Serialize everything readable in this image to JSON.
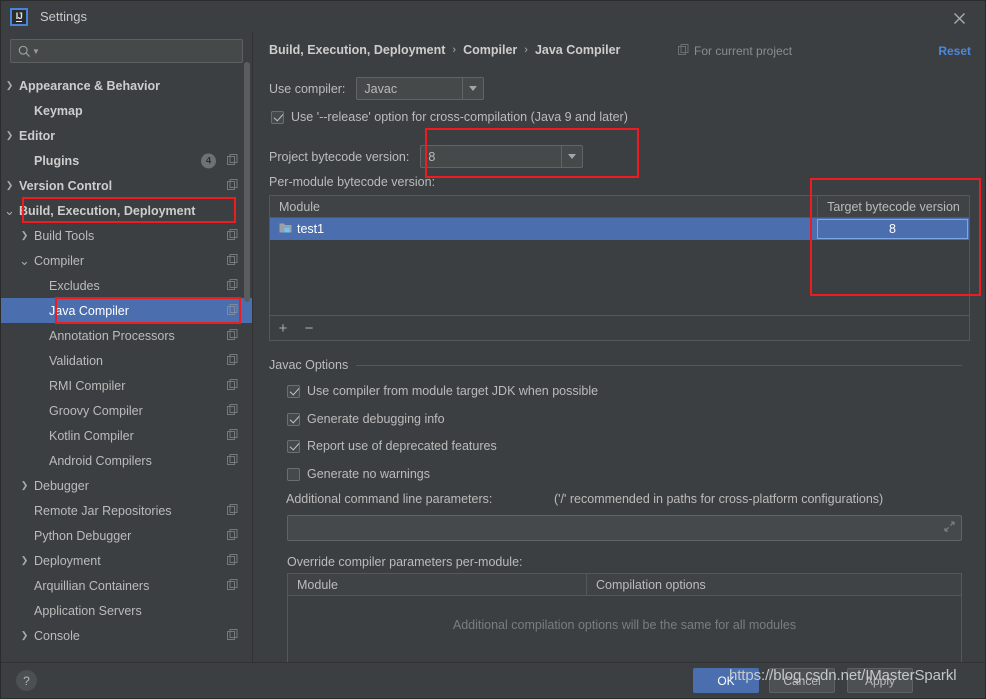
{
  "window": {
    "title": "Settings",
    "logo_text": "IJ",
    "close_icon": "close-icon"
  },
  "sidebar": {
    "search": {
      "placeholder": "",
      "value": "",
      "icon": "search-icon"
    },
    "items": [
      {
        "label": "Appearance & Behavior",
        "arrow": "›",
        "indent": 0,
        "bold": true,
        "copy": false,
        "badge": null,
        "selected": false
      },
      {
        "label": "Keymap",
        "arrow": "",
        "indent": 1,
        "bold": true,
        "copy": false,
        "badge": null,
        "selected": false
      },
      {
        "label": "Editor",
        "arrow": "›",
        "indent": 0,
        "bold": true,
        "copy": false,
        "badge": null,
        "selected": false
      },
      {
        "label": "Plugins",
        "arrow": "",
        "indent": 1,
        "bold": true,
        "copy": true,
        "badge": "4",
        "selected": false
      },
      {
        "label": "Version Control",
        "arrow": "›",
        "indent": 0,
        "bold": true,
        "copy": true,
        "badge": null,
        "selected": false
      },
      {
        "label": "Build, Execution, Deployment",
        "arrow": "∨",
        "indent": 0,
        "bold": true,
        "copy": false,
        "badge": null,
        "selected": false
      },
      {
        "label": "Build Tools",
        "arrow": "›",
        "indent": 1,
        "bold": false,
        "copy": true,
        "badge": null,
        "selected": false
      },
      {
        "label": "Compiler",
        "arrow": "∨",
        "indent": 1,
        "bold": false,
        "copy": true,
        "badge": null,
        "selected": false
      },
      {
        "label": "Excludes",
        "arrow": "",
        "indent": 2,
        "bold": false,
        "copy": true,
        "badge": null,
        "selected": false
      },
      {
        "label": "Java Compiler",
        "arrow": "",
        "indent": 2,
        "bold": false,
        "copy": true,
        "badge": null,
        "selected": true
      },
      {
        "label": "Annotation Processors",
        "arrow": "",
        "indent": 2,
        "bold": false,
        "copy": true,
        "badge": null,
        "selected": false
      },
      {
        "label": "Validation",
        "arrow": "",
        "indent": 2,
        "bold": false,
        "copy": true,
        "badge": null,
        "selected": false
      },
      {
        "label": "RMI Compiler",
        "arrow": "",
        "indent": 2,
        "bold": false,
        "copy": true,
        "badge": null,
        "selected": false
      },
      {
        "label": "Groovy Compiler",
        "arrow": "",
        "indent": 2,
        "bold": false,
        "copy": true,
        "badge": null,
        "selected": false
      },
      {
        "label": "Kotlin Compiler",
        "arrow": "",
        "indent": 2,
        "bold": false,
        "copy": true,
        "badge": null,
        "selected": false
      },
      {
        "label": "Android Compilers",
        "arrow": "",
        "indent": 2,
        "bold": false,
        "copy": true,
        "badge": null,
        "selected": false
      },
      {
        "label": "Debugger",
        "arrow": "›",
        "indent": 1,
        "bold": false,
        "copy": false,
        "badge": null,
        "selected": false
      },
      {
        "label": "Remote Jar Repositories",
        "arrow": "",
        "indent": 1,
        "bold": false,
        "copy": true,
        "badge": null,
        "selected": false
      },
      {
        "label": "Python Debugger",
        "arrow": "",
        "indent": 1,
        "bold": false,
        "copy": true,
        "badge": null,
        "selected": false
      },
      {
        "label": "Deployment",
        "arrow": "›",
        "indent": 1,
        "bold": false,
        "copy": true,
        "badge": null,
        "selected": false
      },
      {
        "label": "Arquillian Containers",
        "arrow": "",
        "indent": 1,
        "bold": false,
        "copy": true,
        "badge": null,
        "selected": false
      },
      {
        "label": "Application Servers",
        "arrow": "",
        "indent": 1,
        "bold": false,
        "copy": false,
        "badge": null,
        "selected": false
      },
      {
        "label": "Console",
        "arrow": "›",
        "indent": 1,
        "bold": false,
        "copy": true,
        "badge": null,
        "selected": false
      }
    ]
  },
  "main": {
    "breadcrumb": [
      "Build, Execution, Deployment",
      "Compiler",
      "Java Compiler"
    ],
    "breadcrumb_separator": "›",
    "scope_label": "For current project",
    "reset_label": "Reset",
    "use_compiler_label": "Use compiler:",
    "use_compiler_value": "Javac",
    "release_option_label": "Use '--release' option for cross-compilation (Java 9 and later)",
    "release_option_checked": true,
    "project_bytecode_label": "Project bytecode version:",
    "project_bytecode_value": "8",
    "per_module_label": "Per-module bytecode version:",
    "module_table": {
      "headers": [
        "Module",
        "Target bytecode version"
      ],
      "rows": [
        {
          "module": "test1",
          "target": "8",
          "selected": true,
          "editing": true
        }
      ],
      "toolbar": {
        "add": "+",
        "remove": "−"
      }
    },
    "javac_group_title": "Javac Options",
    "javac_options": [
      {
        "label": "Use compiler from module target JDK when possible",
        "checked": true
      },
      {
        "label": "Generate debugging info",
        "checked": true
      },
      {
        "label": "Report use of deprecated features",
        "checked": true
      },
      {
        "label": "Generate no warnings",
        "checked": false
      }
    ],
    "additional_params_label": "Additional command line parameters:",
    "additional_params_hint": "('/' recommended in paths for cross-platform configurations)",
    "additional_params_value": "",
    "override_label": "Override compiler parameters per-module:",
    "override_table": {
      "headers": [
        "Module",
        "Compilation options"
      ],
      "empty_message": "Additional compilation options will be the same for all modules"
    }
  },
  "footer": {
    "help_label": "?",
    "ok_label": "OK",
    "cancel_label": "Cancel",
    "apply_label": "Apply"
  },
  "watermark": "https://blog.csdn.net/IMasterSparkl",
  "colors": {
    "selection_blue": "#4b6eaf",
    "link_blue": "#4a88e0",
    "annotation_red": "#ee1c21",
    "panel_bg": "#3c3f41"
  }
}
